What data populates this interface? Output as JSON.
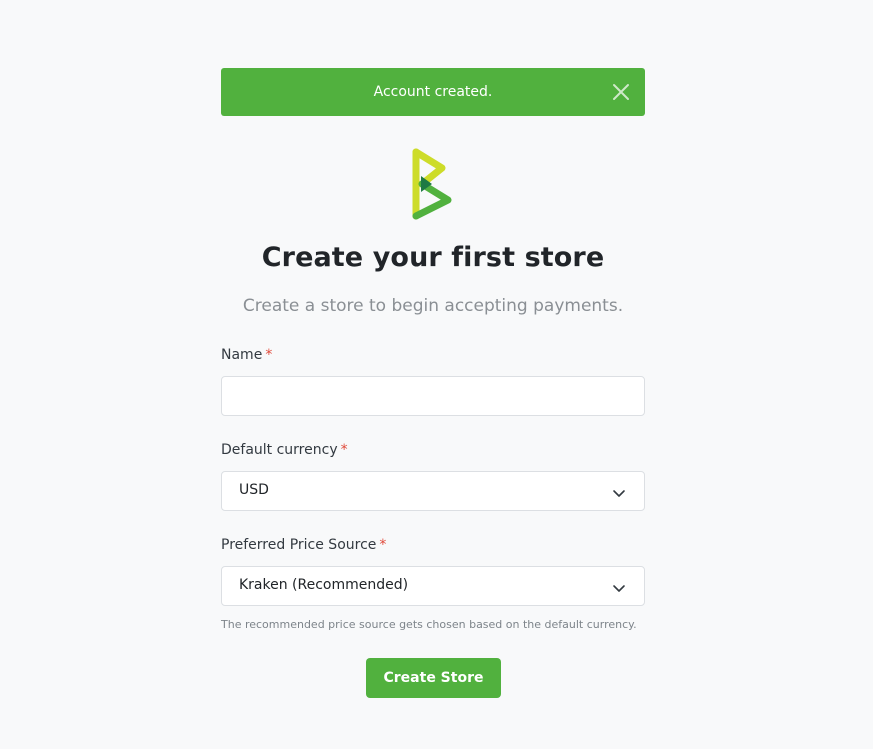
{
  "alert": {
    "message": "Account created.",
    "close_icon": "close-icon",
    "color": "#51b13e"
  },
  "logo": {
    "icon": "btcpay-logo-icon"
  },
  "page": {
    "title": "Create your first store",
    "subtitle": "Create a store to begin accepting payments."
  },
  "form": {
    "name": {
      "label": "Name",
      "required_mark": "*",
      "value": "",
      "placeholder": ""
    },
    "currency": {
      "label": "Default currency",
      "required_mark": "*",
      "value": "USD",
      "icon": "chevron-down-icon"
    },
    "price_source": {
      "label": "Preferred Price Source",
      "required_mark": "*",
      "value": "Kraken (Recommended)",
      "icon": "chevron-down-icon",
      "help": "The recommended price source gets chosen based on the default currency."
    },
    "submit_label": "Create Store"
  },
  "colors": {
    "primary": "#51b13e",
    "required": "#e04a3a",
    "background": "#f8f9fa"
  }
}
